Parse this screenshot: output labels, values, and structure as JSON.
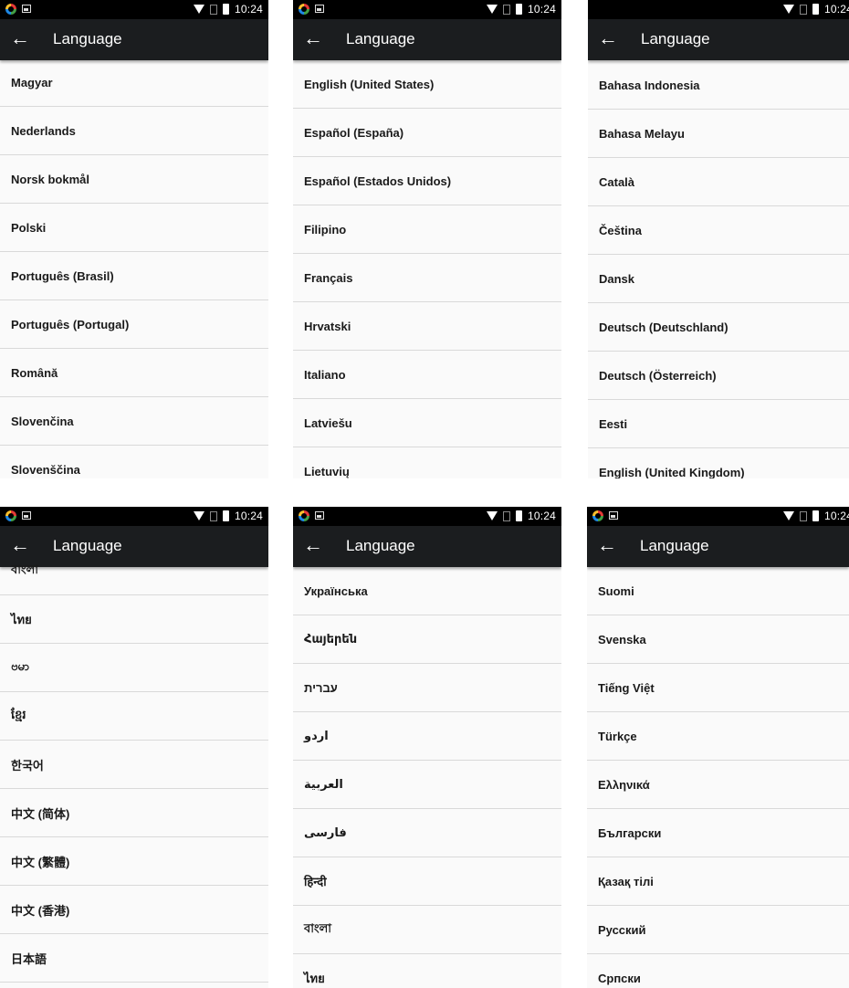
{
  "status_time": "10:24",
  "title": "Language",
  "panels": [
    {
      "items": [
        "Magyar",
        "Nederlands",
        "Norsk bokmål",
        "Polski",
        "Português (Brasil)",
        "Português (Portugal)",
        "Română",
        "Slovenčina",
        "Slovenščina"
      ]
    },
    {
      "items": [
        "English (United States)",
        "Español (España)",
        "Español (Estados Unidos)",
        "Filipino",
        "Français",
        "Hrvatski",
        "Italiano",
        "Latviešu",
        "Lietuvių"
      ]
    },
    {
      "items": [
        "Bahasa Indonesia",
        "Bahasa Melayu",
        "Català",
        "Čeština",
        "Dansk",
        "Deutsch (Deutschland)",
        "Deutsch (Österreich)",
        "Eesti",
        "English (United Kingdom)"
      ]
    },
    {
      "items": [
        "বাংলা",
        "ไทย",
        "ဗမာ",
        "ខ្មែរ",
        "한국어",
        "中文 (简体)",
        "中文 (繁體)",
        "中文 (香港)",
        "日本語"
      ]
    },
    {
      "items": [
        "Українська",
        "Հայերեն",
        "עברית",
        "اردو",
        "العربية",
        "فارسی",
        "हिन्दी",
        "বাংলা",
        "ไทย"
      ]
    },
    {
      "items": [
        "Suomi",
        "Svenska",
        "Tiếng Việt",
        "Türkçe",
        "Ελληνικά",
        "Български",
        "Қазақ тілі",
        "Русский",
        "Српски"
      ]
    }
  ]
}
